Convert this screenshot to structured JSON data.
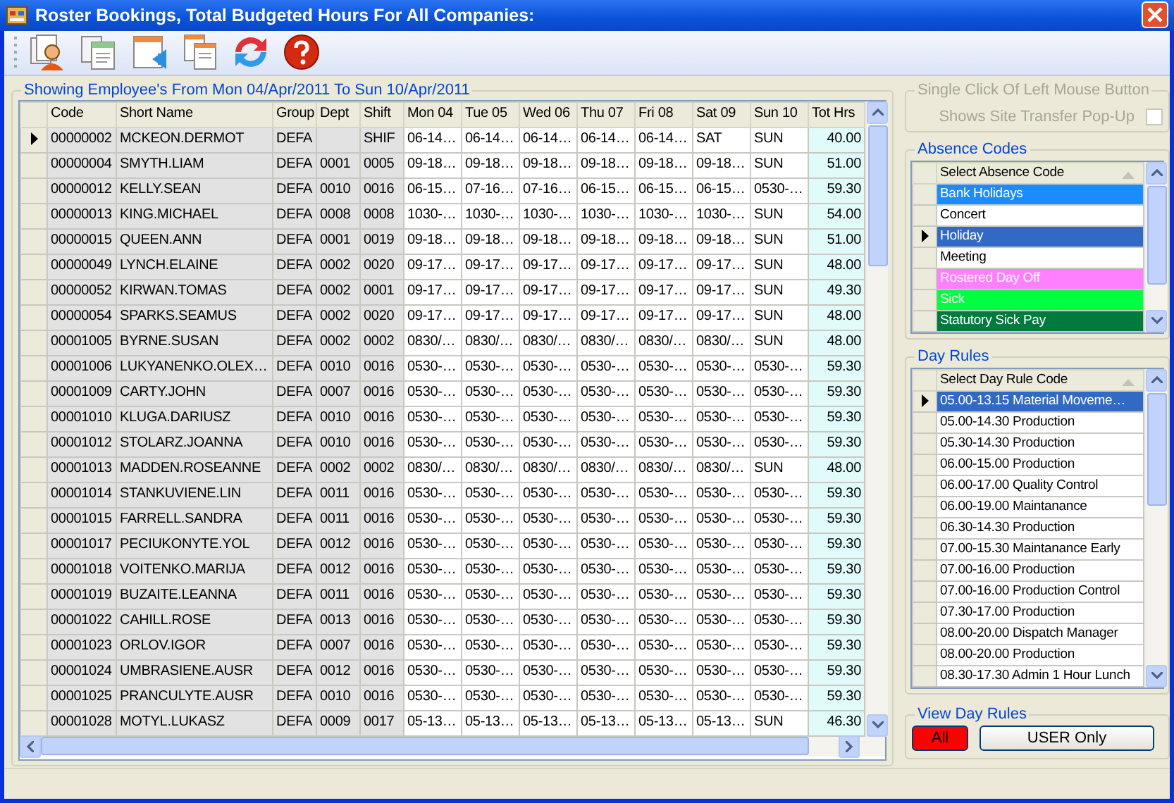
{
  "window": {
    "title": "Roster Bookings, Total Budgeted Hours For All Companies:"
  },
  "toolbar": {
    "buttons": [
      {
        "kind": "employee"
      },
      {
        "kind": "documents"
      },
      {
        "kind": "import"
      },
      {
        "kind": "copy"
      },
      {
        "kind": "refresh"
      },
      {
        "kind": "help"
      }
    ]
  },
  "roster": {
    "caption": "Showing Employee's From Mon 04/Apr/2011 To Sun 10/Apr/2011",
    "columns": [
      "Code",
      "Short Name",
      "Group",
      "Dept",
      "Shift",
      "Mon 04",
      "Tue 05",
      "Wed 06",
      "Thu 07",
      "Fri 08",
      "Sat 09",
      "Sun 10",
      "Tot Hrs"
    ],
    "rows": [
      {
        "selected": true,
        "cells": [
          "00000002",
          "MCKEON.DERMOT",
          "DEFA",
          "",
          "SHIF",
          "06-14…",
          "06-14…",
          "06-14…",
          "06-14…",
          "06-14…",
          "SAT",
          "SUN",
          "40.00"
        ]
      },
      {
        "selected": false,
        "cells": [
          "00000004",
          "SMYTH.LIAM",
          "DEFA",
          "0001",
          "0005",
          "09-18…",
          "09-18…",
          "09-18…",
          "09-18…",
          "09-18…",
          "09-18…",
          "SUN",
          "51.00"
        ]
      },
      {
        "selected": false,
        "cells": [
          "00000012",
          "KELLY.SEAN",
          "DEFA",
          "0010",
          "0016",
          "06-15…",
          "07-16…",
          "07-16…",
          "06-15…",
          "06-15…",
          "06-15…",
          "0530-…",
          "59.30"
        ]
      },
      {
        "selected": false,
        "cells": [
          "00000013",
          "KING.MICHAEL",
          "DEFA",
          "0008",
          "0008",
          "1030-…",
          "1030-…",
          "1030-…",
          "1030-…",
          "1030-…",
          "1030-…",
          "SUN",
          "54.00"
        ]
      },
      {
        "selected": false,
        "cells": [
          "00000015",
          "QUEEN.ANN",
          "DEFA",
          "0001",
          "0019",
          "09-18…",
          "09-18…",
          "09-18…",
          "09-18…",
          "09-18…",
          "09-18…",
          "SUN",
          "51.00"
        ]
      },
      {
        "selected": false,
        "cells": [
          "00000049",
          "LYNCH.ELAINE",
          "DEFA",
          "0002",
          "0020",
          "09-17…",
          "09-17…",
          "09-17…",
          "09-17…",
          "09-17…",
          "09-17…",
          "SUN",
          "48.00"
        ]
      },
      {
        "selected": false,
        "cells": [
          "00000052",
          "KIRWAN.TOMAS",
          "DEFA",
          "0002",
          "0001",
          "09-17…",
          "09-17…",
          "09-17…",
          "09-17…",
          "09-17…",
          "09-17…",
          "SUN",
          "49.30"
        ]
      },
      {
        "selected": false,
        "cells": [
          "00000054",
          "SPARKS.SEAMUS",
          "DEFA",
          "0002",
          "0020",
          "09-17…",
          "09-17…",
          "09-17…",
          "09-17…",
          "09-17…",
          "09-17…",
          "SUN",
          "48.00"
        ]
      },
      {
        "selected": false,
        "cells": [
          "00001005",
          "BYRNE.SUSAN",
          "DEFA",
          "0002",
          "0002",
          "0830/…",
          "0830/…",
          "0830/…",
          "0830/…",
          "0830/…",
          "0830/…",
          "SUN",
          "48.00"
        ]
      },
      {
        "selected": false,
        "cells": [
          "00001006",
          "LUKYANENKO.OLEX…",
          "DEFA",
          "0010",
          "0016",
          "0530-…",
          "0530-…",
          "0530-…",
          "0530-…",
          "0530-…",
          "0530-…",
          "0530-…",
          "59.30"
        ]
      },
      {
        "selected": false,
        "cells": [
          "00001009",
          "CARTY.JOHN",
          "DEFA",
          "0007",
          "0016",
          "0530-…",
          "0530-…",
          "0530-…",
          "0530-…",
          "0530-…",
          "0530-…",
          "0530-…",
          "59.30"
        ]
      },
      {
        "selected": false,
        "cells": [
          "00001010",
          "KLUGA.DARIUSZ",
          "DEFA",
          "0010",
          "0016",
          "0530-…",
          "0530-…",
          "0530-…",
          "0530-…",
          "0530-…",
          "0530-…",
          "0530-…",
          "59.30"
        ]
      },
      {
        "selected": false,
        "cells": [
          "00001012",
          "STOLARZ.JOANNA",
          "DEFA",
          "0010",
          "0016",
          "0530-…",
          "0530-…",
          "0530-…",
          "0530-…",
          "0530-…",
          "0530-…",
          "0530-…",
          "59.30"
        ]
      },
      {
        "selected": false,
        "cells": [
          "00001013",
          "MADDEN.ROSEANNE",
          "DEFA",
          "0002",
          "0002",
          "0830/…",
          "0830/…",
          "0830/…",
          "0830/…",
          "0830/…",
          "0830/…",
          "SUN",
          "48.00"
        ]
      },
      {
        "selected": false,
        "cells": [
          "00001014",
          "STANKUVIENE.LIN",
          "DEFA",
          "0011",
          "0016",
          "0530-…",
          "0530-…",
          "0530-…",
          "0530-…",
          "0530-…",
          "0530-…",
          "0530-…",
          "59.30"
        ]
      },
      {
        "selected": false,
        "cells": [
          "00001015",
          "FARRELL.SANDRA",
          "DEFA",
          "0011",
          "0016",
          "0530-…",
          "0530-…",
          "0530-…",
          "0530-…",
          "0530-…",
          "0530-…",
          "0530-…",
          "59.30"
        ]
      },
      {
        "selected": false,
        "cells": [
          "00001017",
          "PECIUKONYTE.YOL",
          "DEFA",
          "0012",
          "0016",
          "0530-…",
          "0530-…",
          "0530-…",
          "0530-…",
          "0530-…",
          "0530-…",
          "0530-…",
          "59.30"
        ]
      },
      {
        "selected": false,
        "cells": [
          "00001018",
          "VOITENKO.MARIJA",
          "DEFA",
          "0012",
          "0016",
          "0530-…",
          "0530-…",
          "0530-…",
          "0530-…",
          "0530-…",
          "0530-…",
          "0530-…",
          "59.30"
        ]
      },
      {
        "selected": false,
        "cells": [
          "00001019",
          "BUZAITE.LEANNA",
          "DEFA",
          "0011",
          "0016",
          "0530-…",
          "0530-…",
          "0530-…",
          "0530-…",
          "0530-…",
          "0530-…",
          "0530-…",
          "59.30"
        ]
      },
      {
        "selected": false,
        "cells": [
          "00001022",
          "CAHILL.ROSE",
          "DEFA",
          "0013",
          "0016",
          "0530-…",
          "0530-…",
          "0530-…",
          "0530-…",
          "0530-…",
          "0530-…",
          "0530-…",
          "59.30"
        ]
      },
      {
        "selected": false,
        "cells": [
          "00001023",
          "ORLOV.IGOR",
          "DEFA",
          "0007",
          "0016",
          "0530-…",
          "0530-…",
          "0530-…",
          "0530-…",
          "0530-…",
          "0530-…",
          "0530-…",
          "59.30"
        ]
      },
      {
        "selected": false,
        "cells": [
          "00001024",
          "UMBRASIENE.AUSR",
          "DEFA",
          "0012",
          "0016",
          "0530-…",
          "0530-…",
          "0530-…",
          "0530-…",
          "0530-…",
          "0530-…",
          "0530-…",
          "59.30"
        ]
      },
      {
        "selected": false,
        "cells": [
          "00001025",
          "PRANCULYTE.AUSR",
          "DEFA",
          "0010",
          "0016",
          "0530-…",
          "0530-…",
          "0530-…",
          "0530-…",
          "0530-…",
          "0530-…",
          "0530-…",
          "59.30"
        ]
      },
      {
        "selected": false,
        "cells": [
          "00001028",
          "MOTYL.LUKASZ",
          "DEFA",
          "0009",
          "0017",
          "05-13…",
          "05-13…",
          "05-13…",
          "05-13…",
          "05-13…",
          "05-13…",
          "SUN",
          "46.30"
        ]
      }
    ]
  },
  "site_transfer": {
    "title": "Single Click Of Left Mouse Button",
    "label": "Shows Site Transfer Pop-Up",
    "checked": false,
    "disabled": true
  },
  "absence_codes": {
    "title": "Absence Codes",
    "column": "Select Absence Code",
    "items": [
      {
        "label": "Bank Holidays",
        "color": "#1a8cff",
        "selected": false
      },
      {
        "label": "Concert",
        "color": "#ffffff",
        "selected": false
      },
      {
        "label": "Holiday",
        "color": "#316ac5",
        "selected": true
      },
      {
        "label": "Meeting",
        "color": "#ffffff",
        "selected": false
      },
      {
        "label": "Rostered Day Off",
        "color": "#ff80ff",
        "selected": false
      },
      {
        "label": "Sick",
        "color": "#00ff40",
        "selected": false
      },
      {
        "label": "Statutory Sick Pay",
        "color": "#007a3d",
        "selected": false
      }
    ]
  },
  "day_rules": {
    "title": "Day Rules",
    "column": "Select Day Rule Code",
    "items": [
      {
        "label": "05.00-13.15 Material Moveme…",
        "selected": true
      },
      {
        "label": "05.00-14.30 Production",
        "selected": false
      },
      {
        "label": "05.30-14.30 Production",
        "selected": false
      },
      {
        "label": "06.00-15.00 Production",
        "selected": false
      },
      {
        "label": "06.00-17.00 Quality Control",
        "selected": false
      },
      {
        "label": "06.00-19.00 Maintanance",
        "selected": false
      },
      {
        "label": "06.30-14.30 Production",
        "selected": false
      },
      {
        "label": "07.00-15.30 Maintanance Early",
        "selected": false
      },
      {
        "label": "07.00-16.00 Production",
        "selected": false
      },
      {
        "label": "07.00-16.00 Production Control",
        "selected": false
      },
      {
        "label": "07.30-17.00 Production",
        "selected": false
      },
      {
        "label": "08.00-20.00 Dispatch Manager",
        "selected": false
      },
      {
        "label": "08.00-20.00 Production",
        "selected": false
      },
      {
        "label": "08.30-17.30 Admin 1 Hour Lunch",
        "selected": false
      }
    ]
  },
  "view_day_rules": {
    "title": "View Day Rules",
    "buttons": [
      {
        "label": "All",
        "selected": true
      },
      {
        "label": "USER Only",
        "selected": false
      }
    ]
  }
}
